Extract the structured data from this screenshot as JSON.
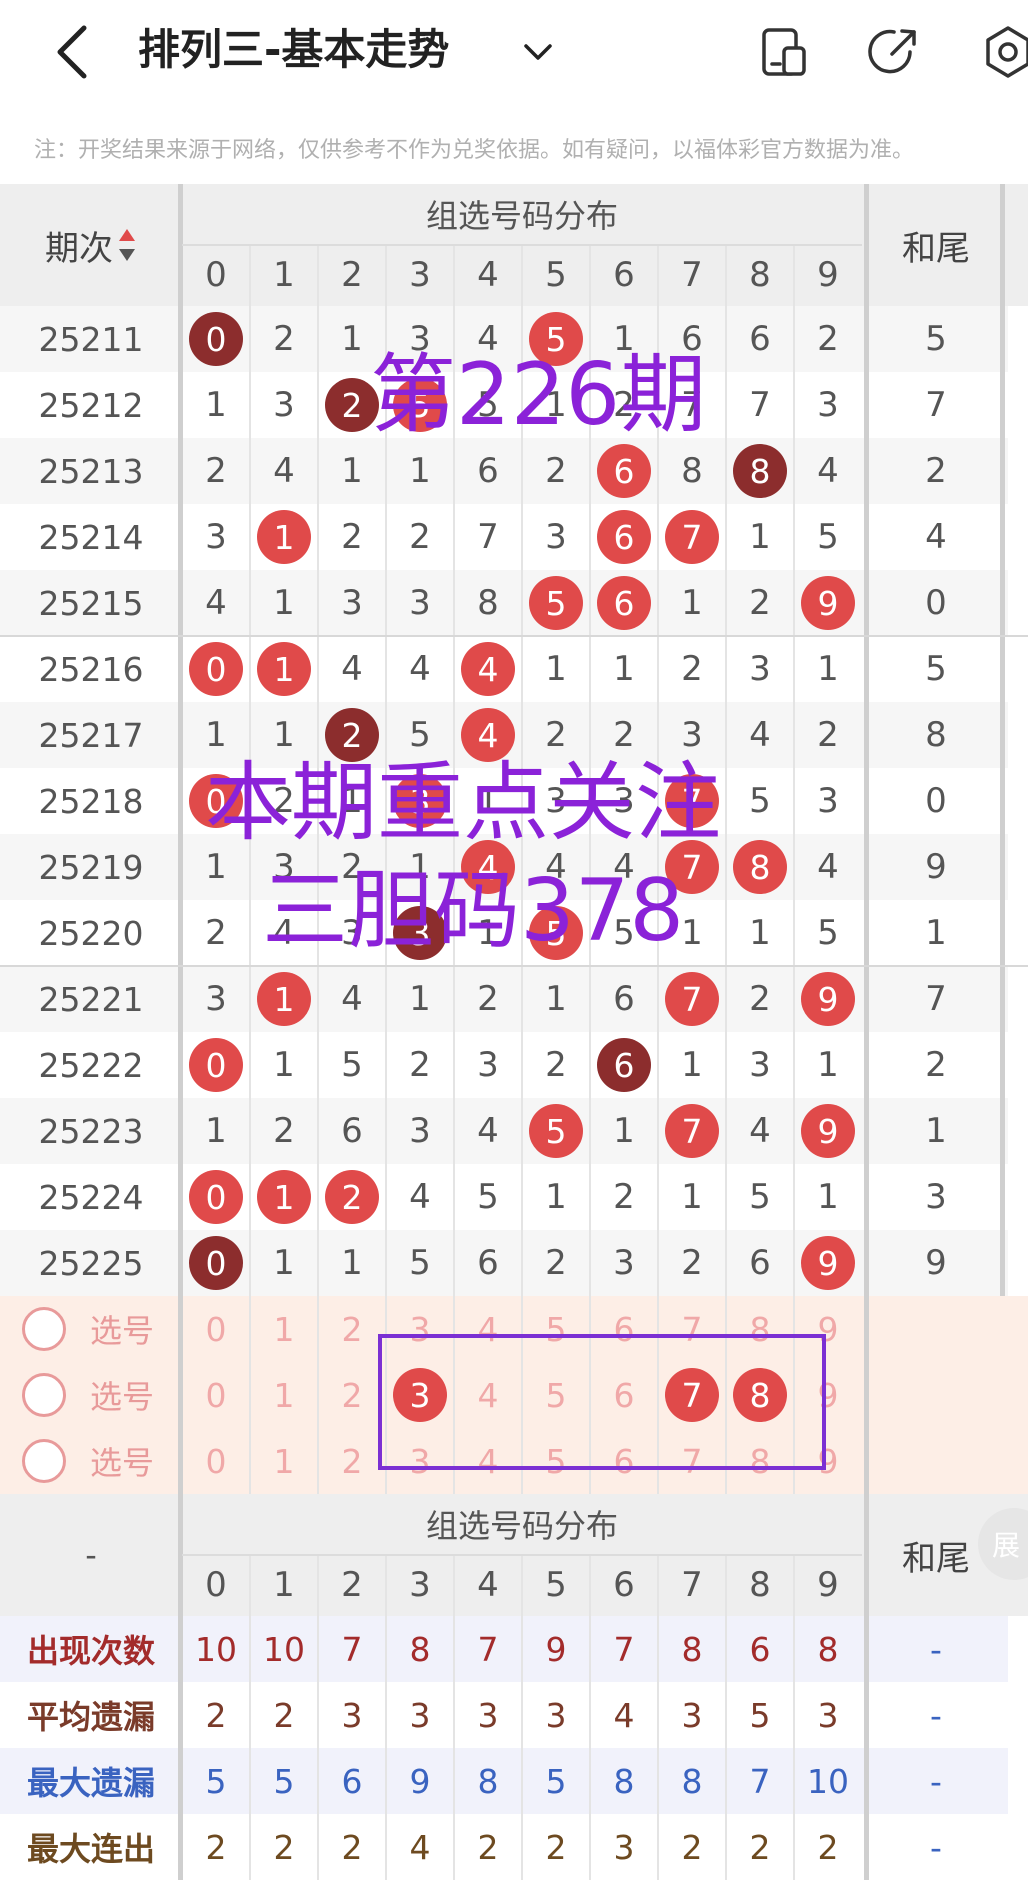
{
  "header": {
    "title": "排列三-基本走势",
    "notice": "注：开奖结果来源于网络，仅供参考不作为兑奖依据。如有疑问，以福体彩官方数据为准。"
  },
  "table": {
    "period_header": "期次",
    "group_header": "组选号码分布",
    "tail_header": "和尾",
    "digits": [
      "0",
      "1",
      "2",
      "3",
      "4",
      "5",
      "6",
      "7",
      "8",
      "9"
    ],
    "rows": [
      {
        "period": "25211",
        "cells": [
          "0",
          "2",
          "1",
          "3",
          "4",
          "5",
          "1",
          "6",
          "6",
          "2"
        ],
        "balls": {
          "0": "dark",
          "5": "red"
        },
        "tail": "5"
      },
      {
        "period": "25212",
        "cells": [
          "1",
          "3",
          "2",
          "5",
          "5",
          "1",
          "2",
          "7",
          "7",
          "3"
        ],
        "balls": {
          "2": "dark",
          "3": "red"
        },
        "tail": "7"
      },
      {
        "period": "25213",
        "cells": [
          "2",
          "4",
          "1",
          "1",
          "6",
          "2",
          "6",
          "8",
          "8",
          "4"
        ],
        "balls": {
          "6": "red",
          "8": "dark"
        },
        "tail": "2"
      },
      {
        "period": "25214",
        "cells": [
          "3",
          "1",
          "2",
          "2",
          "7",
          "3",
          "6",
          "7",
          "1",
          "5"
        ],
        "balls": {
          "1": "red",
          "6": "red",
          "7": "red"
        },
        "tail": "4"
      },
      {
        "period": "25215",
        "cells": [
          "4",
          "1",
          "3",
          "3",
          "8",
          "5",
          "6",
          "1",
          "2",
          "9"
        ],
        "balls": {
          "5": "red",
          "6": "red",
          "9": "red"
        },
        "tail": "0"
      },
      {
        "period": "25216",
        "cells": [
          "0",
          "1",
          "4",
          "4",
          "4",
          "1",
          "1",
          "2",
          "3",
          "1"
        ],
        "balls": {
          "0": "red",
          "1": "red",
          "4": "red"
        },
        "tail": "5"
      },
      {
        "period": "25217",
        "cells": [
          "1",
          "1",
          "2",
          "5",
          "4",
          "2",
          "2",
          "3",
          "4",
          "2"
        ],
        "balls": {
          "2": "dark",
          "4": "red"
        },
        "tail": "8"
      },
      {
        "period": "25218",
        "cells": [
          "0",
          "2",
          "1",
          "3",
          "1",
          "3",
          "3",
          "7",
          "5",
          "3"
        ],
        "balls": {
          "0": "red",
          "3": "red",
          "7": "red"
        },
        "tail": "0"
      },
      {
        "period": "25219",
        "cells": [
          "1",
          "3",
          "2",
          "1",
          "4",
          "4",
          "4",
          "7",
          "8",
          "4"
        ],
        "balls": {
          "4": "red",
          "7": "red",
          "8": "red"
        },
        "tail": "9"
      },
      {
        "period": "25220",
        "cells": [
          "2",
          "4",
          "3",
          "3",
          "1",
          "5",
          "5",
          "1",
          "1",
          "5"
        ],
        "balls": {
          "3": "dark",
          "5": "red"
        },
        "tail": "1"
      },
      {
        "period": "25221",
        "cells": [
          "3",
          "1",
          "4",
          "1",
          "2",
          "1",
          "6",
          "7",
          "2",
          "9"
        ],
        "balls": {
          "1": "red",
          "7": "red",
          "9": "red"
        },
        "tail": "7"
      },
      {
        "period": "25222",
        "cells": [
          "0",
          "1",
          "5",
          "2",
          "3",
          "2",
          "6",
          "1",
          "3",
          "1"
        ],
        "balls": {
          "0": "red",
          "6": "dark"
        },
        "tail": "2"
      },
      {
        "period": "25223",
        "cells": [
          "1",
          "2",
          "6",
          "3",
          "4",
          "5",
          "1",
          "7",
          "4",
          "9"
        ],
        "balls": {
          "5": "red",
          "7": "red",
          "9": "red"
        },
        "tail": "1"
      },
      {
        "period": "25224",
        "cells": [
          "0",
          "1",
          "2",
          "4",
          "5",
          "1",
          "2",
          "1",
          "5",
          "1"
        ],
        "balls": {
          "0": "red",
          "1": "red",
          "2": "red"
        },
        "tail": "3"
      },
      {
        "period": "25225",
        "cells": [
          "0",
          "1",
          "1",
          "5",
          "6",
          "2",
          "3",
          "2",
          "6",
          "9"
        ],
        "balls": {
          "0": "dark",
          "9": "red"
        },
        "tail": "9"
      }
    ],
    "select_rows": [
      {
        "label": "选号",
        "picked": []
      },
      {
        "label": "选号",
        "picked": [
          "3",
          "7",
          "8"
        ]
      },
      {
        "label": "选号",
        "picked": []
      }
    ],
    "stats_dash": "-",
    "stats": [
      {
        "label": "出现次数",
        "values": [
          "10",
          "10",
          "7",
          "8",
          "7",
          "9",
          "7",
          "8",
          "6",
          "8"
        ],
        "tail": "-",
        "color": "#a32b2b"
      },
      {
        "label": "平均遗漏",
        "values": [
          "2",
          "2",
          "3",
          "3",
          "3",
          "3",
          "4",
          "3",
          "5",
          "3"
        ],
        "tail": "-",
        "color": "#7a3b2a"
      },
      {
        "label": "最大遗漏",
        "values": [
          "5",
          "5",
          "6",
          "9",
          "8",
          "5",
          "8",
          "8",
          "7",
          "10"
        ],
        "tail": "-",
        "color": "#3a63c0"
      },
      {
        "label": "最大连出",
        "values": [
          "2",
          "2",
          "2",
          "4",
          "2",
          "2",
          "3",
          "2",
          "2",
          "2"
        ],
        "tail": "-",
        "color": "#6d4a20"
      }
    ],
    "fold_label": "展"
  },
  "overlays": {
    "period_text": "第226期",
    "focus_line1": "本期重点关注",
    "focus_line2": "三胆码378"
  },
  "colors": {
    "ball_red": "#e04a4a",
    "ball_dark": "#8c2d2d",
    "overlay_purple": "#8b22d8",
    "select_bg": "#fdeee6"
  }
}
